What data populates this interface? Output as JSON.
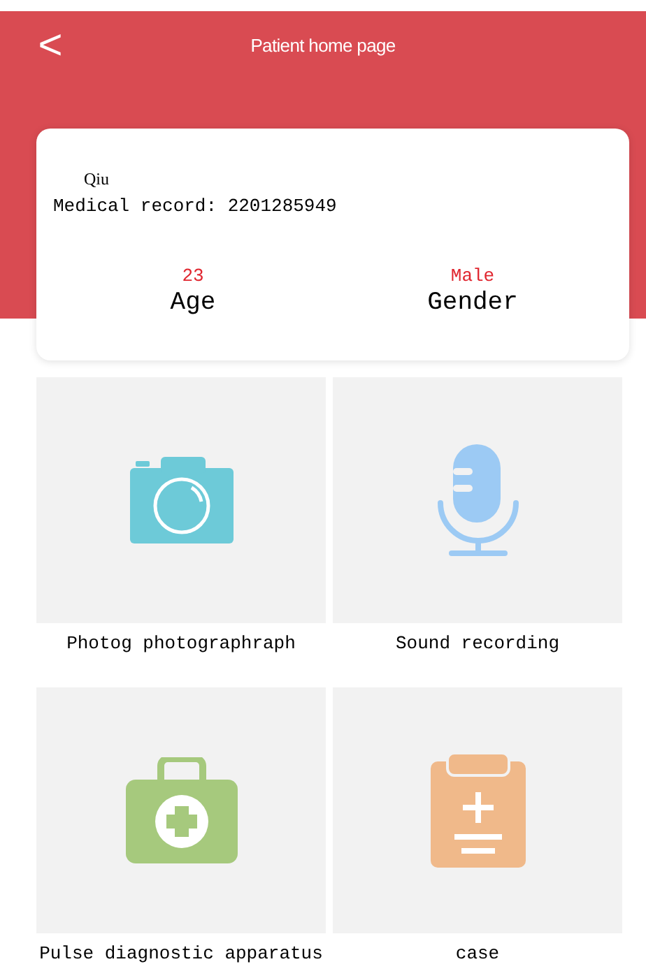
{
  "header": {
    "back": "<",
    "title": "Patient home page"
  },
  "patient": {
    "name": "Qiu",
    "record": "Medical record: 2201285949",
    "stats": [
      {
        "value": "23",
        "label": "Age"
      },
      {
        "value": "Male",
        "label": "Gender"
      }
    ]
  },
  "tiles": [
    {
      "kind": "camera",
      "label": "Photog photographraph"
    },
    {
      "kind": "microphone",
      "label": "Sound recording"
    },
    {
      "kind": "medkit",
      "label": "Pulse diagnostic apparatus"
    },
    {
      "kind": "clipboard",
      "label": "case"
    }
  ]
}
